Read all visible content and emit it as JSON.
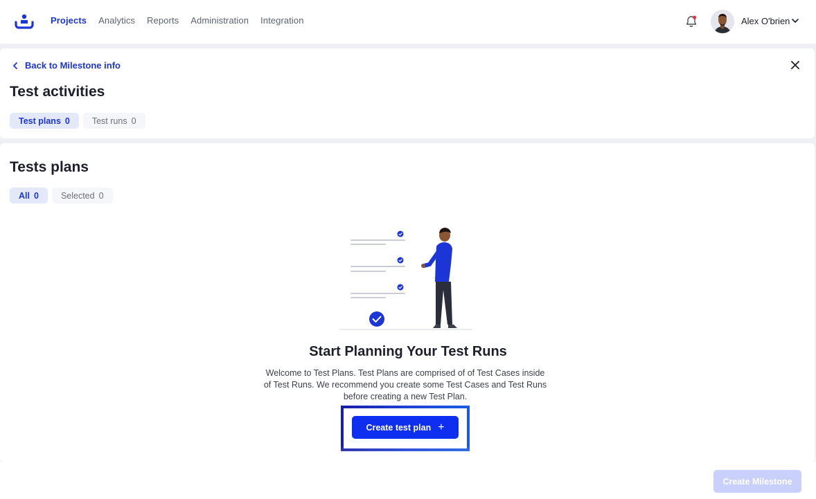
{
  "nav": {
    "items": [
      {
        "label": "Projects",
        "active": true
      },
      {
        "label": "Analytics"
      },
      {
        "label": "Reports"
      },
      {
        "label": "Administration"
      },
      {
        "label": "Integration"
      }
    ]
  },
  "user": {
    "name": "Alex O'brien"
  },
  "activities": {
    "back_label": "Back to Milestone info",
    "title": "Test activities",
    "tabs": [
      {
        "label": "Test plans",
        "count": "0",
        "active": true
      },
      {
        "label": "Test runs",
        "count": "0"
      }
    ]
  },
  "plans": {
    "title": "Tests plans",
    "filters": [
      {
        "label": "All",
        "count": "0",
        "active": true
      },
      {
        "label": "Selected",
        "count": "0"
      }
    ],
    "empty_title": "Start Planning Your Test Runs",
    "empty_desc": "Welcome to Test Plans. Test Plans are comprised of  of Test Cases inside of Test Runs. We recommend you create some Test Cases and Test Runs before creating a new Test Plan.",
    "create_label": "Create test plan",
    "create_icon": "plus-icon"
  },
  "footer": {
    "create_milestone_label": "Create Milestone"
  },
  "colors": {
    "primary": "#0f2ff0",
    "link": "#1b35d6",
    "disabled": "#c9d0fb",
    "notification_dot": "#e5333c"
  }
}
